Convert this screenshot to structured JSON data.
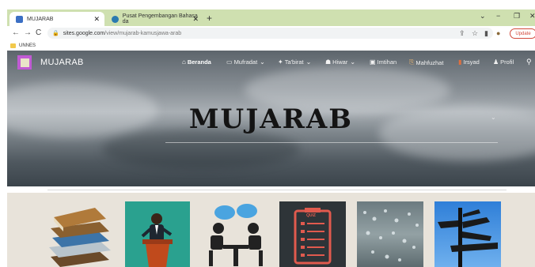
{
  "browser": {
    "tabs": [
      {
        "title": "MUJARAB",
        "active": true
      },
      {
        "title": "Pusat Pengembangan Bahasa da",
        "active": false
      }
    ],
    "new_tab": "+",
    "url_host": "sites.google.com",
    "url_path": "/view/mujarab-kamusjawa-arab",
    "update_label": "Update",
    "bookmark": "UNNES"
  },
  "site": {
    "name": "MUJARAB",
    "hero_title": "MUJARAB",
    "nav": [
      {
        "label": "Beranda",
        "icon": "home-icon"
      },
      {
        "label": "Mufradat",
        "icon": "book-icon"
      },
      {
        "label": "Ta'birat",
        "icon": "pin-icon"
      },
      {
        "label": "Hiwar",
        "icon": "people-icon"
      },
      {
        "label": "Imtihan",
        "icon": "test-icon"
      },
      {
        "label": "Mahfuzhat",
        "icon": "scroll-icon"
      },
      {
        "label": "Irsyad",
        "icon": "guide-icon"
      },
      {
        "label": "Profil",
        "icon": "person-icon"
      }
    ]
  },
  "tiles": [
    {
      "name": "books"
    },
    {
      "name": "speaker"
    },
    {
      "name": "conversation"
    },
    {
      "name": "quiz",
      "label": "QUIZ"
    },
    {
      "name": "rain-drops"
    },
    {
      "name": "signpost"
    }
  ],
  "colors": {
    "tab_strip": "#cfe0b0",
    "logo": "#c15bd4",
    "update_accent": "#d24a3c",
    "hero_title": "#141414"
  }
}
